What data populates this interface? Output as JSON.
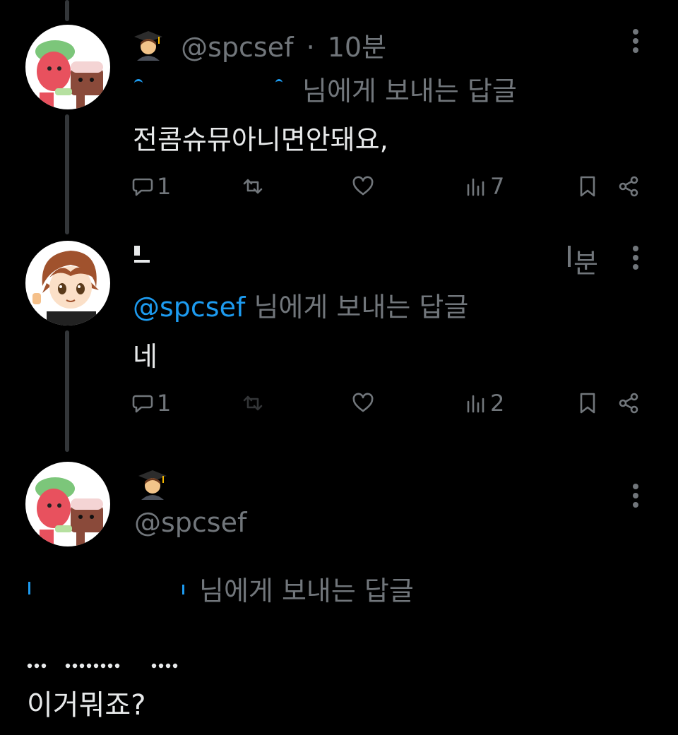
{
  "posts": [
    {
      "emoji": "🧑‍🎓",
      "handle": "@spcsef",
      "dot": "·",
      "time": "10분",
      "reply_handle": "",
      "reply_suffix": "님에게 보내는 답글",
      "text": "전콤슈뮤아니면안돼요,",
      "replies": "1",
      "views": "7"
    },
    {
      "time": "분",
      "reply_handle": "@spcsef",
      "reply_suffix": "님에게 보내는 답글",
      "text": "네",
      "replies": "1",
      "views": "2"
    },
    {
      "emoji": "🧑‍🎓",
      "handle": "@spcsef",
      "reply_suffix": "님에게 보내는 답글",
      "text": "이거뭐죠?"
    }
  ],
  "icons": {
    "more": "more-vertical-icon",
    "reply": "reply-bubble-icon",
    "repost": "repost-icon",
    "like": "heart-icon",
    "views": "views-bar-chart-icon",
    "bookmark": "bookmark-icon",
    "share": "share-icon"
  },
  "colors": {
    "background": "#000000",
    "muted": "#71767b",
    "link": "#1d9bf0",
    "text": "#e7e9ea"
  }
}
